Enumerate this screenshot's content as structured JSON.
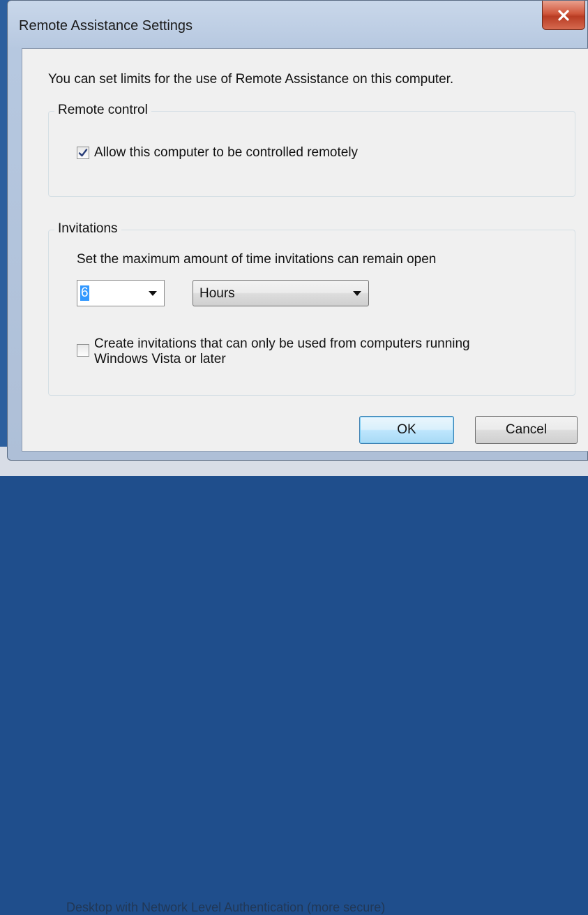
{
  "window": {
    "title": "Remote Assistance Settings"
  },
  "intro": "You can set limits for the use of Remote Assistance on this computer.",
  "remote_control": {
    "legend": "Remote control",
    "allow_label": "Allow this computer to be controlled remotely",
    "allow_checked": true
  },
  "invitations": {
    "legend": "Invitations",
    "max_time_label": "Set the maximum amount of time invitations can remain open",
    "amount_value": "6",
    "unit_value": "Hours",
    "vista_label": "Create invitations that can only be used from computers running Windows Vista or later",
    "vista_checked": false
  },
  "buttons": {
    "ok": "OK",
    "cancel": "Cancel"
  },
  "background_text": "Desktop with Network Level Authentication (more secure)",
  "colors": {
    "accent": "#3399ff",
    "close": "#c94a31",
    "title_bar": "#c9d7ea"
  }
}
